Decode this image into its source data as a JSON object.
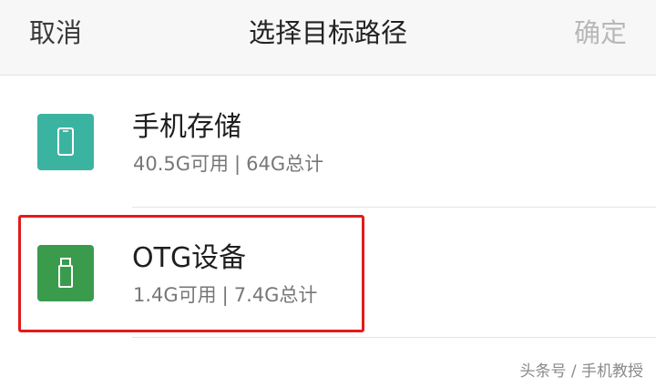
{
  "header": {
    "cancel_label": "取消",
    "title": "选择目标路径",
    "confirm_label": "确定"
  },
  "storage_items": [
    {
      "name": "手机存储",
      "available": "40.5G可用",
      "separator": "|",
      "total": "64G总计",
      "icon": "phone-icon",
      "icon_color": "#3bb3a1"
    },
    {
      "name": "OTG设备",
      "available": "1.4G可用",
      "separator": "|",
      "total": "7.4G总计",
      "icon": "usb-drive-icon",
      "icon_color": "#3a9b4d"
    }
  ],
  "highlight_color": "#e21b1b",
  "watermark": "头条号 / 手机教授"
}
